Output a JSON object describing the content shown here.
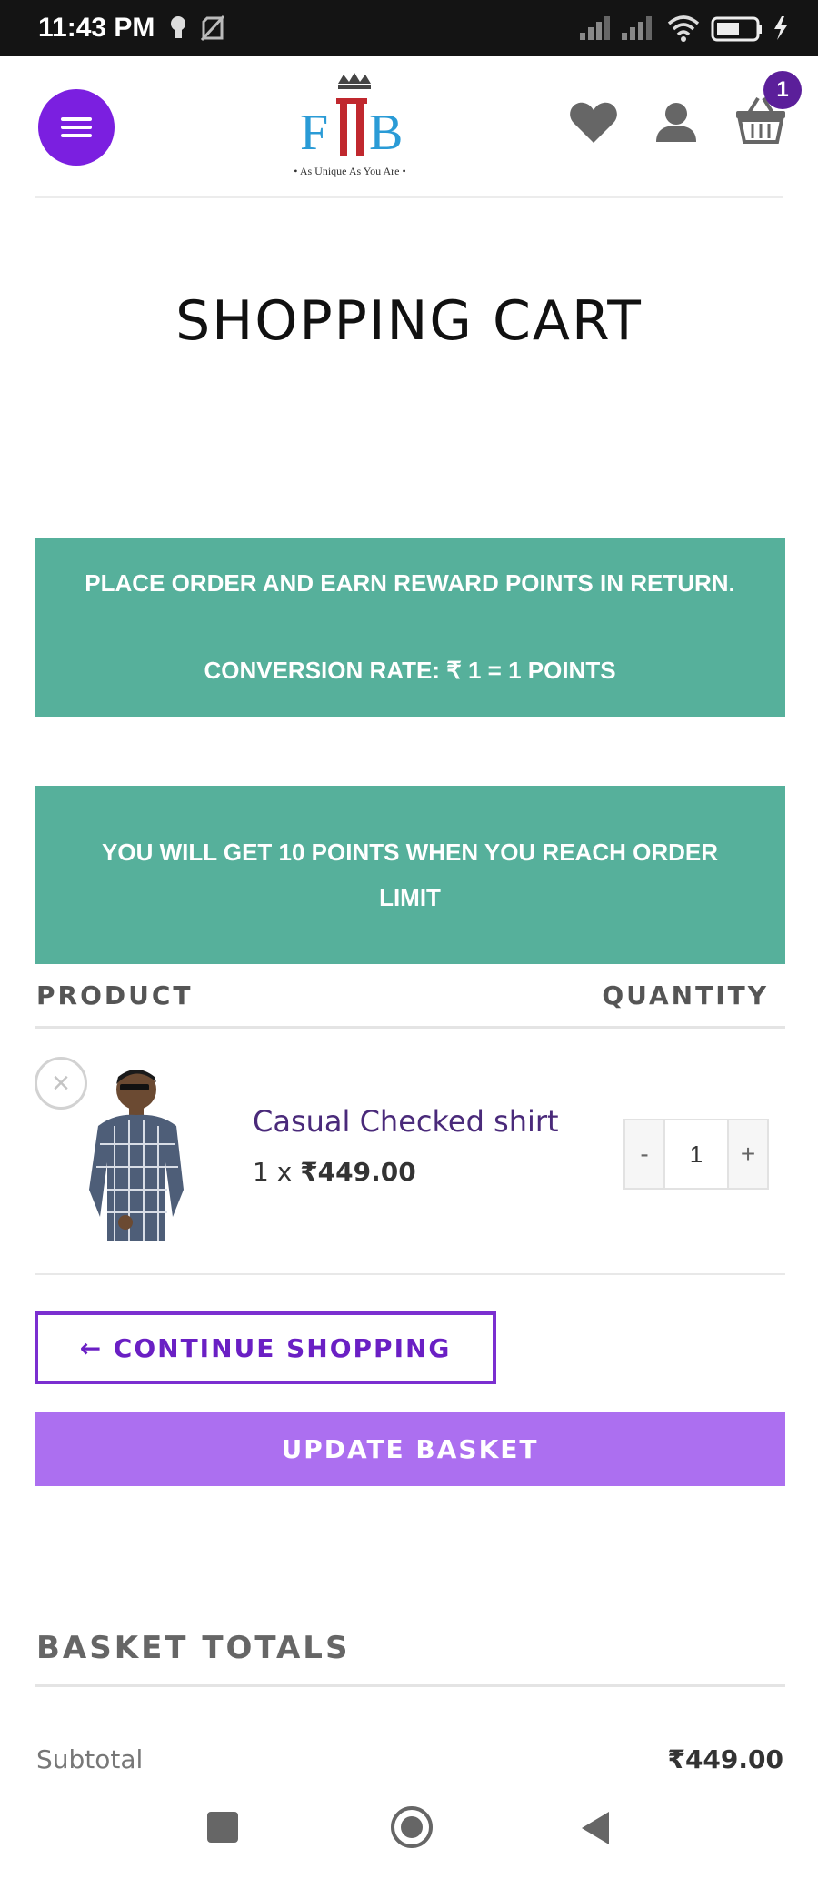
{
  "status_bar": {
    "time": "11:43 PM",
    "icons": [
      "notification-icon",
      "sim-off-icon",
      "signal-icon",
      "signal-icon",
      "wifi-icon",
      "battery-icon",
      "charging-icon"
    ]
  },
  "header": {
    "logo_text_left": "F",
    "logo_text_right": "B",
    "logo_tagline": "• As Unique As You Are •",
    "cart_count": "1"
  },
  "page": {
    "title": "SHOPPING CART"
  },
  "notices": {
    "reward_line1": "PLACE ORDER AND EARN REWARD POINTS IN RETURN.",
    "reward_line2": "CONVERSION RATE: ₹ 1 = 1 POINTS",
    "points_message": "YOU WILL GET 10 POINTS WHEN YOU REACH ORDER LIMIT"
  },
  "table": {
    "col_product": "PRODUCT",
    "col_quantity": "QUANTITY"
  },
  "cart_item": {
    "remove_symbol": "×",
    "name": "Casual Checked shirt",
    "qty_prefix": "1 x ",
    "price": "₹449.00",
    "minus": "-",
    "quantity": "1",
    "plus": "+"
  },
  "buttons": {
    "continue_shopping": "← CONTINUE SHOPPING",
    "update_basket": "UPDATE BASKET"
  },
  "totals": {
    "title": "BASKET TOTALS",
    "subtotal_label": "Subtotal",
    "subtotal_value": "₹449.00"
  },
  "colors": {
    "accent_purple": "#7b1fe0",
    "notice_teal": "#56b09b",
    "update_button": "#ac6ff0"
  }
}
